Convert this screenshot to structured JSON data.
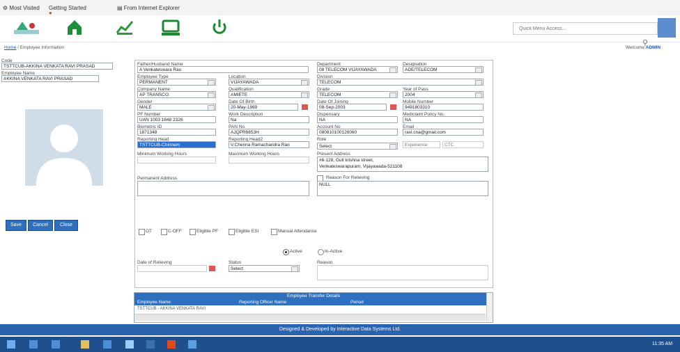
{
  "bookmarks": {
    "most_visited": "Most Visited",
    "getting_started": "Getting Started",
    "from_ie": "From Internet Explorer"
  },
  "header": {
    "search_placeholder": "Quick Menu Access..."
  },
  "breadcrumb": {
    "home": "Home",
    "current": "Employee Information",
    "welcome": "Welcome",
    "user": "ADMIN"
  },
  "left": {
    "code_label": "Code",
    "code_value": "TSTTCUB-AKKINA VENKATA RAVI PRASAD",
    "employee_name_label": "Employee Name",
    "employee_name_value": "AKKINA VENKATA RAVI PRASAD",
    "save": "Save",
    "cancel": "Cancel",
    "close": "Close"
  },
  "form": {
    "father_label": "Father/Husband Name",
    "father_value": "A Venkateswara Rao",
    "emp_type_label": "Employee Type",
    "emp_type_value": "PERMANENT",
    "location_label": "Location",
    "location_value": "VIJAYAWADA",
    "company_label": "Company Name",
    "company_value": "AP TRANSCO",
    "qualification_label": "Qualification",
    "qualification_value": "AMIETE",
    "gender_label": "Gender",
    "gender_value": "MALE",
    "dob_label": "Date Of Birth",
    "dob_value": "20-May-1969",
    "pf_label": "PF Number",
    "pf_value": "UAN 1003 1848 2326",
    "work_label": "Work Description",
    "work_value": "Na",
    "bio_label": "Biometric ID",
    "bio_value": "1871348",
    "pan_label": "PAN No.",
    "pan_value": "AJQPR6653H",
    "rep_head_label": "Reporting Head",
    "rep_head_value": "TSTTCUB-Chinnam",
    "rep_head2_label": "Reporting Head2",
    "rep_head2_value": "V.Chenna Ramachandra Rao",
    "min_hours_label": "Minimum Working Hours",
    "max_hours_label": "Maximum Working Hours",
    "dept_label": "Department",
    "dept_value": "08 TELECOM VIJAYAWADA",
    "desig_label": "Designation",
    "desig_value": "ADE/TELECOM",
    "division_label": "Division",
    "division_value": "TELECOM",
    "grade_label": "Grade",
    "grade_value": "TELECOM",
    "yop_label": "Year of Pass",
    "yop_value": "2004",
    "doj_label": "Date Of Joining",
    "doj_value": "08-Sep-2003",
    "mobile_label": "Mobile Number",
    "mobile_value": "9491803310",
    "dispensary_label": "Dispensary",
    "dispensary_value": "NA",
    "mediclaim_label": "Mediclaim Policy No.",
    "mediclaim_value": "NA",
    "account_label": "Account No",
    "account_value": "080810100126060",
    "email_label": "Email",
    "email_value": "ravi.cna@gmail.com",
    "role_label": "Role",
    "role_value": "Select",
    "exp_label": "Experience",
    "ctc_label": "CTC",
    "present_addr_label": "Present Address",
    "present_addr_line1": "#6-128, Gull krishna street,",
    "present_addr_line2": "Venkateswarapuram, Vijayawada-521108",
    "permanent_addr_label": "Permanent Address",
    "relieve_label": "Reason For Relieving",
    "relieve_value": "NULL",
    "chk_ot": "OT",
    "chk_coff": "C-OFF",
    "chk_pf": "Eligible PF",
    "chk_esi": "Eligible ESI",
    "chk_att": "Manual Attendance",
    "active": "Active",
    "inactive": "In-Active",
    "dor_label": "Date of Relieving",
    "status_label": "Status",
    "status_value": "Select",
    "reason_label": "Reason"
  },
  "transfer": {
    "title": "Employee Transfer Details",
    "col_employee": "Employee Name",
    "col_reporting": "Reporting Officer Name",
    "col_period": "Period",
    "row1": "TSTTCUB - AKKINA VENKATA RAVI"
  },
  "footer": "Designed & Developed by Interactive Data Systems Ltd.",
  "taskbar": {
    "time": "11:35 AM"
  },
  "colors": {
    "accent": "#2e6fc0",
    "footer": "#2a63b0",
    "taskbar": "#1f4f8c"
  }
}
